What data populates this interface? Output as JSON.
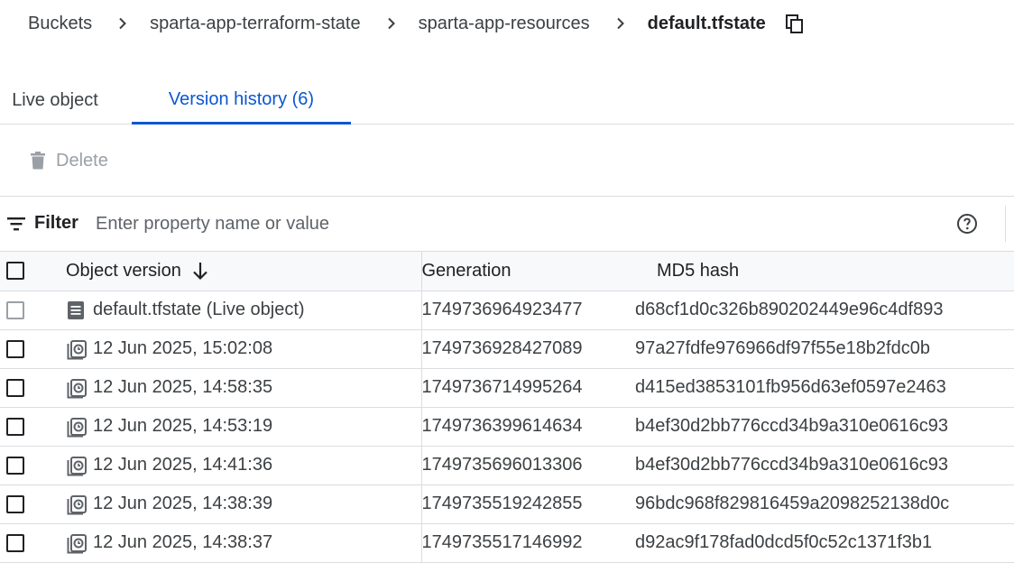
{
  "breadcrumb": {
    "items": [
      "Buckets",
      "sparta-app-terraform-state",
      "sparta-app-resources"
    ],
    "current": "default.tfstate",
    "copy_icon": "copy-icon",
    "separator_icon": "chevron-right-icon"
  },
  "tabs": [
    {
      "label": "Live object",
      "active": false
    },
    {
      "label": "Version history (6)",
      "active": true
    }
  ],
  "toolbar": {
    "delete_label": "Delete",
    "delete_icon": "trash-icon",
    "delete_enabled": false
  },
  "filter": {
    "label": "Filter",
    "placeholder": "Enter property name or value",
    "value": "",
    "icon": "filter-list-icon",
    "help_icon": "help-icon"
  },
  "table": {
    "columns": [
      "Object version",
      "Generation",
      "MD5 hash"
    ],
    "sort": {
      "column": "Object version",
      "direction": "descending"
    },
    "rows": [
      {
        "version": "default.tfstate (Live object)",
        "icon": "document-icon",
        "generation": "1749736964923477",
        "md5": "d68cf1d0c326b890202449e96c4df893",
        "selectable": false
      },
      {
        "version": "12 Jun 2025, 15:02:08",
        "icon": "version-history-icon",
        "generation": "1749736928427089",
        "md5": "97a27fdfe976966df97f55e18b2fdc0b",
        "selectable": true
      },
      {
        "version": "12 Jun 2025, 14:58:35",
        "icon": "version-history-icon",
        "generation": "1749736714995264",
        "md5": "d415ed3853101fb956d63ef0597e2463",
        "selectable": true
      },
      {
        "version": "12 Jun 2025, 14:53:19",
        "icon": "version-history-icon",
        "generation": "1749736399614634",
        "md5": "b4ef30d2bb776ccd34b9a310e0616c93",
        "selectable": true
      },
      {
        "version": "12 Jun 2025, 14:41:36",
        "icon": "version-history-icon",
        "generation": "1749735696013306",
        "md5": "b4ef30d2bb776ccd34b9a310e0616c93",
        "selectable": true
      },
      {
        "version": "12 Jun 2025, 14:38:39",
        "icon": "version-history-icon",
        "generation": "1749735519242855",
        "md5": "96bdc968f829816459a2098252138d0c",
        "selectable": true
      },
      {
        "version": "12 Jun 2025, 14:38:37",
        "icon": "version-history-icon",
        "generation": "1749735517146992",
        "md5": "d92ac9f178fad0dcd5f0c52c1371f3b1",
        "selectable": true
      }
    ]
  },
  "colors": {
    "accent": "#0b57d0",
    "text": "#202124",
    "muted": "#5f6368",
    "disabled": "#9aa0a6",
    "border": "#dadce0",
    "header_bg": "#f8f9fa"
  }
}
